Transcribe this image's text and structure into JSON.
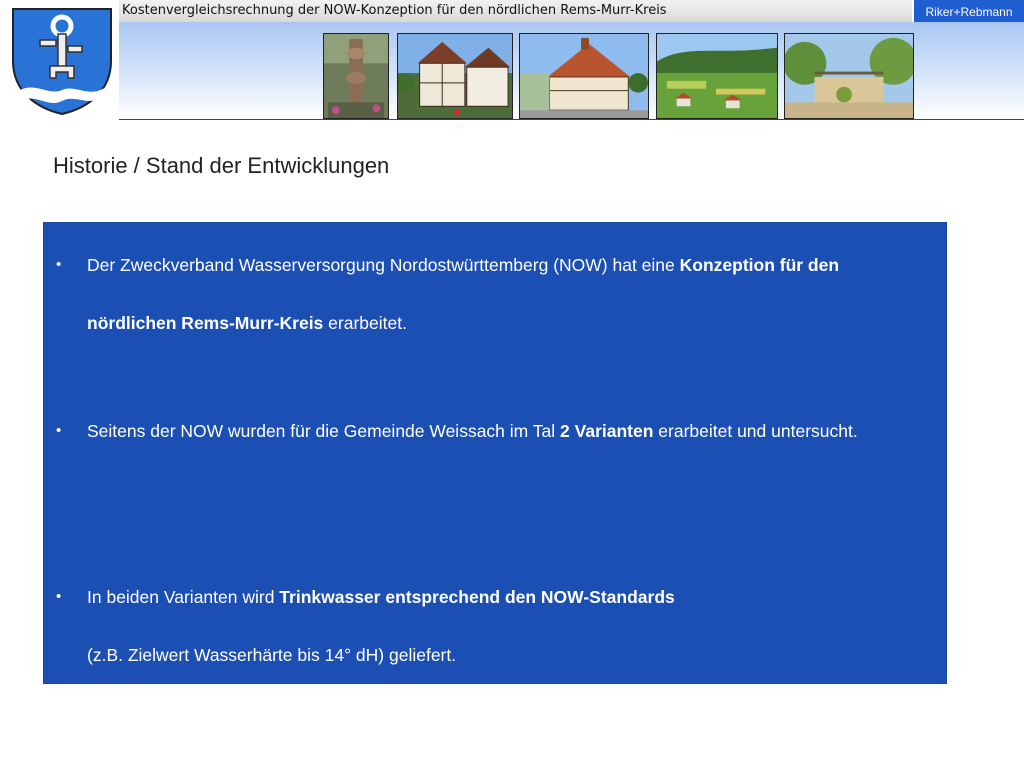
{
  "header": {
    "title": "Kostenvergleichsrechnung der NOW-Konzeption für den nördlichen Rems-Murr-Kreis",
    "brand": "Riker+Rebmann"
  },
  "page_title": "Historie / Stand der Entwicklungen",
  "bullets": [
    {
      "pre": "Der Zweckverband Wasserversorgung Nordostwürttemberg (NOW) hat eine ",
      "bold": "Konzeption für den nördlichen Rems-Murr-Kreis",
      "post": " erarbeitet."
    },
    {
      "pre": "Seitens der NOW wurden für die Gemeinde Weissach im Tal ",
      "bold": "2 Varianten",
      "post": " erarbeitet und untersucht."
    },
    {
      "pre": "In beiden Varianten wird ",
      "bold": "Trinkwasser entsprechend den NOW-Standards",
      "post": "(z.B. Zielwert Wasserhärte bis 14° dH) geliefert."
    }
  ],
  "colors": {
    "panel": "#1c4fb3",
    "brand": "#1f5ed0",
    "crest_blue": "#2a73d6"
  },
  "icons": [
    "coat-of-arms-icon"
  ]
}
